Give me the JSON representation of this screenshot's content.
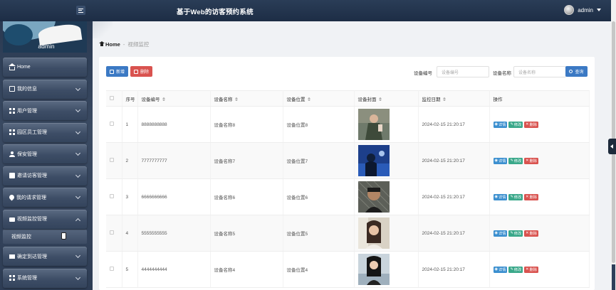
{
  "header": {
    "title": "基于Web的访客预约系统",
    "user": "admin"
  },
  "sidebar": {
    "profile_name": "admin",
    "items": [
      {
        "label": "Home",
        "icon": "home-icon",
        "expandable": false
      },
      {
        "label": "我的信息",
        "icon": "id-card-icon",
        "expandable": true
      },
      {
        "label": "用户管理",
        "icon": "grid-icon",
        "expandable": true
      },
      {
        "label": "园区员工管理",
        "icon": "grid-icon",
        "expandable": true
      },
      {
        "label": "保安管理",
        "icon": "user-icon",
        "expandable": true
      },
      {
        "label": "邀请访客管理",
        "icon": "document-icon",
        "expandable": true
      },
      {
        "label": "我的请求管理",
        "icon": "location-pin-icon",
        "expandable": true
      },
      {
        "label": "视频监控管理",
        "icon": "briefcase-icon",
        "expandable": true,
        "expanded": true,
        "sub": [
          {
            "label": "视频监控"
          }
        ]
      },
      {
        "label": "确定到达管理",
        "icon": "monitor-icon",
        "expandable": true
      },
      {
        "label": "系统管理",
        "icon": "grid-icon",
        "expandable": true
      }
    ]
  },
  "breadcrumb": {
    "home": "Home",
    "separator": "-",
    "current": "视频监控"
  },
  "toolbar": {
    "add_label": "新增",
    "delete_label": "删除",
    "search_label": "查询",
    "filter1_label": "设备编号",
    "filter1_placeholder": "设备编号",
    "filter2_label": "设备名称",
    "filter2_placeholder": "设备名称"
  },
  "table": {
    "headers": [
      "序号",
      "设备编号",
      "设备名称",
      "设备位置",
      "设备封面",
      "监控日期",
      "操作"
    ],
    "rows": [
      {
        "no": "1",
        "code": "8888888888",
        "name": "设备名称8",
        "location": "设备位置8",
        "date": "2024-02-15 21:20:17"
      },
      {
        "no": "2",
        "code": "7777777777",
        "name": "设备名称7",
        "location": "设备位置7",
        "date": "2024-02-15 21:20:17"
      },
      {
        "no": "3",
        "code": "6666666666",
        "name": "设备名称6",
        "location": "设备位置6",
        "date": "2024-02-15 21:20:17"
      },
      {
        "no": "4",
        "code": "5555555555",
        "name": "设备名称5",
        "location": "设备位置5",
        "date": "2024-02-15 21:20:17"
      },
      {
        "no": "5",
        "code": "4444444444",
        "name": "设备名称4",
        "location": "设备位置4",
        "date": "2024-02-15 21:20:17"
      }
    ],
    "actions": {
      "detail": "详情",
      "edit": "修改",
      "remove": "删除"
    }
  }
}
